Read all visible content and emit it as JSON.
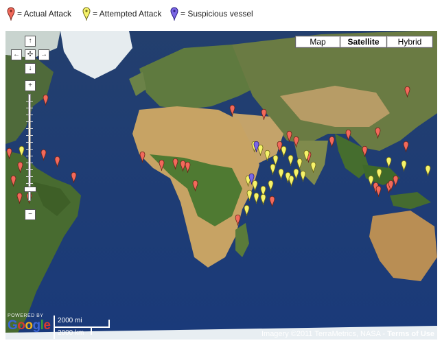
{
  "legend": {
    "actual": {
      "label": "= Actual Attack",
      "color": "#f2695b"
    },
    "attempted": {
      "label": "= Attempted Attack",
      "color": "#f6f36a"
    },
    "suspicious": {
      "label": "= Suspicious vessel",
      "color": "#7b67e6"
    }
  },
  "map_type": {
    "map": "Map",
    "satellite": "Satellite",
    "hybrid": "Hybrid",
    "selected": "Satellite"
  },
  "nav": {
    "up": "↑",
    "left": "←",
    "center": "✣",
    "right": "→",
    "down": "↓",
    "zoom_in": "+",
    "zoom_out": "−"
  },
  "scale": {
    "mi": "2000 mi",
    "km": "2000 km"
  },
  "branding": {
    "powered_by": "POWERED BY",
    "google": "Google"
  },
  "copyright": {
    "text": "Imagery ©2011 TerraMetrics, NASA -",
    "terms": "Terms of Use"
  },
  "colors": {
    "ocean": "#1d3f7a",
    "land": "#5d7a3e",
    "desert": "#b99a62",
    "ice": "#e8eef2"
  }
}
